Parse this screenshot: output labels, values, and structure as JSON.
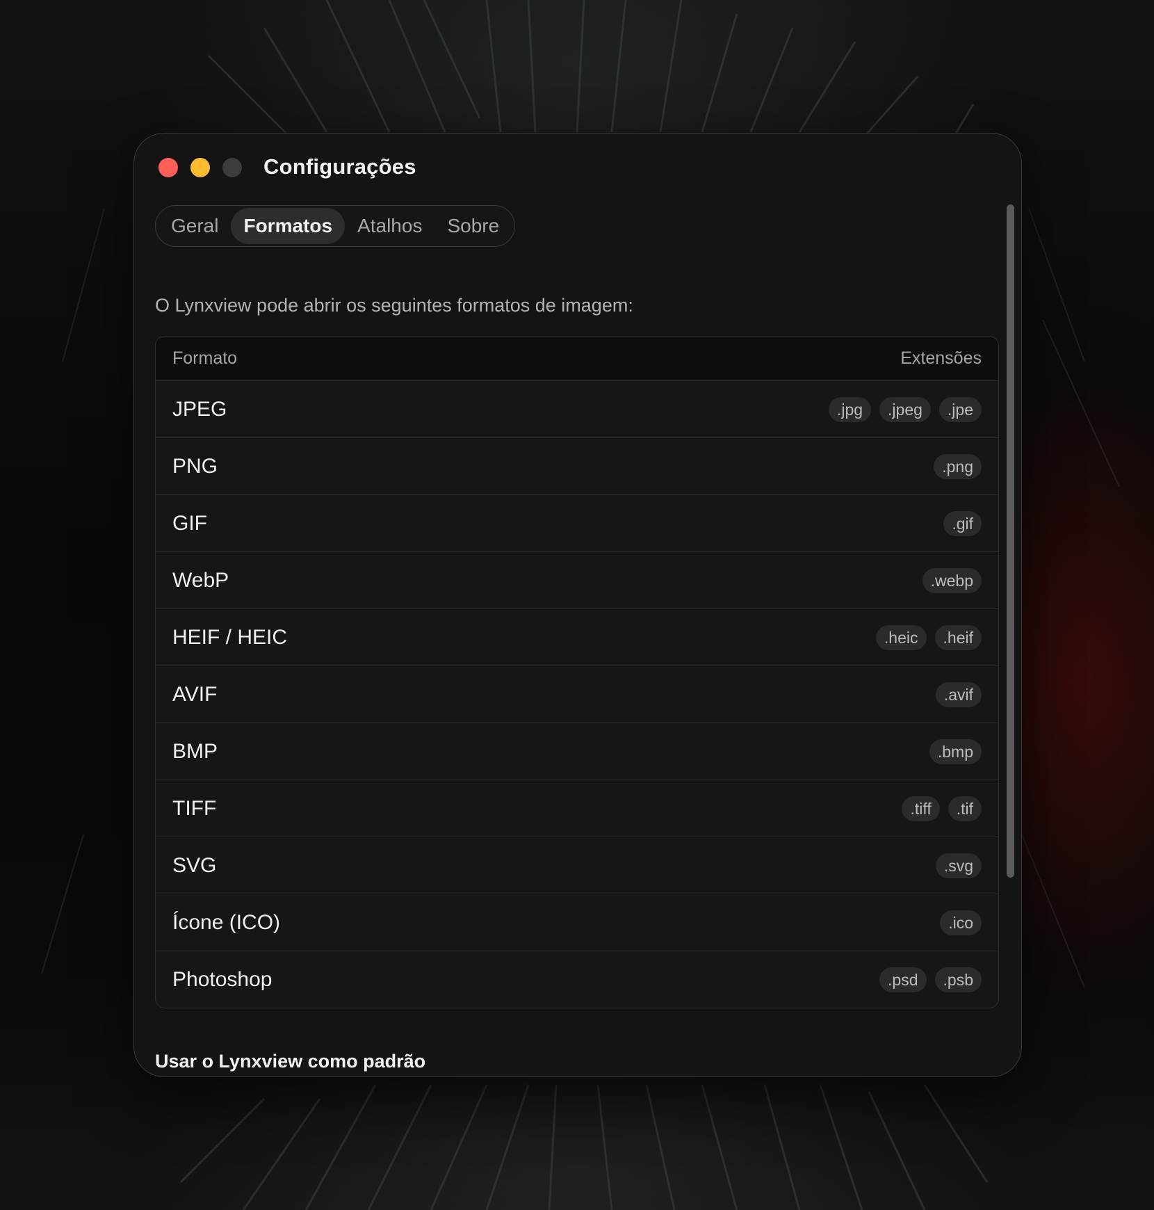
{
  "window": {
    "title": "Configurações",
    "traffic_lights": [
      "close",
      "minimize",
      "zoom-disabled"
    ]
  },
  "tabs": [
    {
      "label": "Geral",
      "active": false
    },
    {
      "label": "Formatos",
      "active": true
    },
    {
      "label": "Atalhos",
      "active": false
    },
    {
      "label": "Sobre",
      "active": false
    }
  ],
  "intro_text": "O Lynxview pode abrir os seguintes formatos de imagem:",
  "table": {
    "headers": {
      "format": "Formato",
      "extensions": "Extensões"
    },
    "rows": [
      {
        "format": "JPEG",
        "extensions": [
          ".jpg",
          ".jpeg",
          ".jpe"
        ]
      },
      {
        "format": "PNG",
        "extensions": [
          ".png"
        ]
      },
      {
        "format": "GIF",
        "extensions": [
          ".gif"
        ]
      },
      {
        "format": "WebP",
        "extensions": [
          ".webp"
        ]
      },
      {
        "format": "HEIF / HEIC",
        "extensions": [
          ".heic",
          ".heif"
        ]
      },
      {
        "format": "AVIF",
        "extensions": [
          ".avif"
        ]
      },
      {
        "format": "BMP",
        "extensions": [
          ".bmp"
        ]
      },
      {
        "format": "TIFF",
        "extensions": [
          ".tiff",
          ".tif"
        ]
      },
      {
        "format": "SVG",
        "extensions": [
          ".svg"
        ]
      },
      {
        "format": "Ícone (ICO)",
        "extensions": [
          ".ico"
        ]
      },
      {
        "format": "Photoshop",
        "extensions": [
          ".psd",
          ".psb"
        ]
      }
    ]
  },
  "default_section_label": "Usar o Lynxview como padrão",
  "colors": {
    "close": "#fe5f57",
    "minimize": "#febc2e",
    "zoom_disabled": "#3c3c3c",
    "window_bg": "#141414",
    "accent_red_background": "#5a0e0a"
  }
}
